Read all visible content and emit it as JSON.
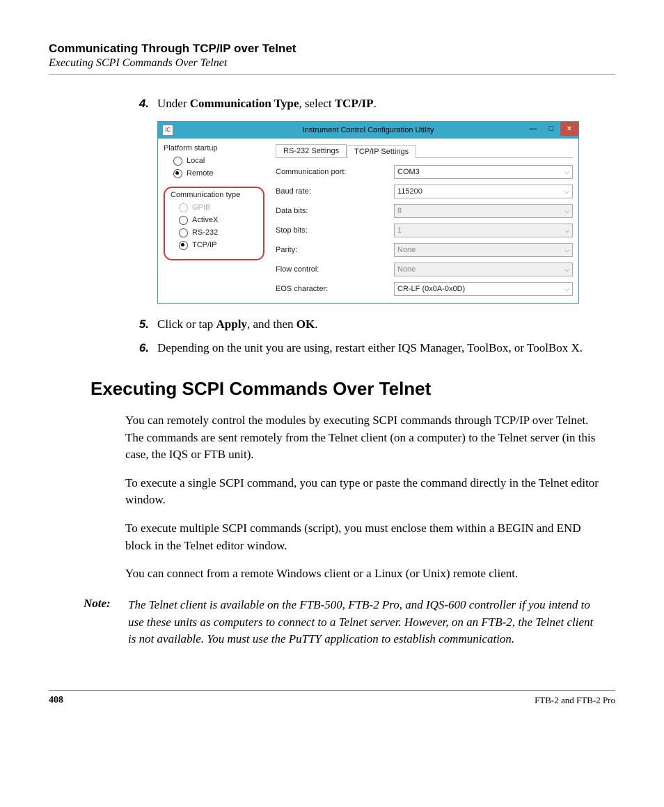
{
  "header": {
    "title": "Communicating Through TCP/IP over Telnet",
    "subtitle": "Executing SCPI Commands Over Telnet"
  },
  "steps": {
    "s4": {
      "num": "4.",
      "pre": "Under ",
      "b1": "Communication Type",
      "mid": ", select ",
      "b2": "TCP/IP",
      "post": "."
    },
    "s5": {
      "num": "5.",
      "pre": "Click or tap ",
      "b1": "Apply",
      "mid": ", and then ",
      "b2": "OK",
      "post": "."
    },
    "s6": {
      "num": "6.",
      "text": "Depending on the unit you are using, restart either IQS Manager, ToolBox, or ToolBox X."
    }
  },
  "win": {
    "icon": "IC",
    "title": "Instrument Control Configuration Utility",
    "min": "—",
    "max": "□",
    "close": "×",
    "platform": {
      "label": "Platform startup",
      "local": "Local",
      "remote": "Remote"
    },
    "comm": {
      "label": "Communication type",
      "gpib": "GPIB",
      "activex": "ActiveX",
      "rs232": "RS-232",
      "tcpip": "TCP/IP"
    },
    "tabs": {
      "rs": "RS-232 Settings",
      "tcp": "TCP/IP Settings"
    },
    "rows": {
      "port": {
        "label": "Communication port:",
        "value": "COM3"
      },
      "baud": {
        "label": "Baud rate:",
        "value": "115200"
      },
      "data": {
        "label": "Data bits:",
        "value": "8"
      },
      "stop": {
        "label": "Stop bits:",
        "value": "1"
      },
      "parity": {
        "label": "Parity:",
        "value": "None"
      },
      "flow": {
        "label": "Flow control:",
        "value": "None"
      },
      "eos": {
        "label": "EOS character:",
        "value": "CR-LF (0x0A-0x0D)"
      }
    }
  },
  "section": {
    "heading": "Executing SCPI Commands Over Telnet",
    "p1": "You can remotely control the modules by executing SCPI commands through TCP/IP over Telnet. The commands are sent remotely from the Telnet client (on a computer) to the Telnet server (in this case, the IQS or FTB unit).",
    "p2": "To execute a single SCPI command, you can type or paste the command directly in the Telnet editor window.",
    "p3": "To execute multiple SCPI commands (script), you must enclose them within a BEGIN and END block in the Telnet editor window.",
    "p4": "You can connect from a remote Windows client or a Linux (or Unix) remote client."
  },
  "note": {
    "label": "Note:",
    "text": "The Telnet client is available on the FTB-500, FTB-2 Pro, and IQS-600 controller if you intend to use these units as computers to connect to a Telnet server. However, on an FTB-2, the Telnet client is not available. You must use the PuTTY application to establish communication."
  },
  "footer": {
    "page": "408",
    "right": "FTB-2 and FTB-2 Pro"
  }
}
